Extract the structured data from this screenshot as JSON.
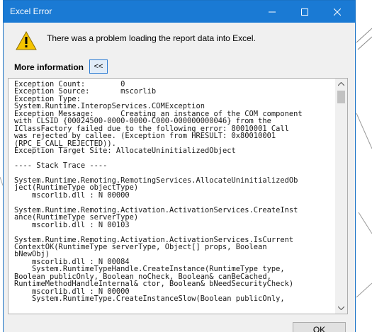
{
  "window": {
    "title": "Excel Error"
  },
  "message": {
    "text": "There was a problem loading the report data into Excel."
  },
  "more_info": {
    "label": "More information",
    "toggle_label": "<<"
  },
  "details": {
    "text": "Exception Count:        0\nException Source:       mscorlib\nException Type:\nSystem.Runtime.InteropServices.COMException\nException Message:      Creating an instance of the COM component\nwith CLSID {00024500-0000-0000-C000-000000000046} from the\nIClassFactory failed due to the following error: 80010001 Call\nwas rejected by callee. (Exception from HRESULT: 0x80010001\n(RPC_E_CALL_REJECTED)).\nException Target Site: AllocateUninitializedObject\n\n---- Stack Trace ----\n\nSystem.Runtime.Remoting.RemotingServices.AllocateUninitializedOb\nject(RuntimeType objectType)\n    mscorlib.dll : N 00000\n\nSystem.Runtime.Remoting.Activation.ActivationServices.CreateInst\nance(RuntimeType serverType)\n    mscorlib.dll : N 00103\n\nSystem.Runtime.Remoting.Activation.ActivationServices.IsCurrent\nContextOK(RuntimeType serverType, Object[] props, Boolean\nbNewObj)\n    mscorlib.dll : N 00084\n    System.RuntimeTypeHandle.CreateInstance(RuntimeType type,\nBoolean publicOnly, Boolean noCheck, Boolean& canBeCached,\nRuntimeMethodHandleInternal& ctor, Boolean& bNeedSecurityCheck)\n    mscorlib.dll : N 00000\n    System.RuntimeType.CreateInstanceSlow(Boolean publicOnly,"
  },
  "buttons": {
    "ok_label": "OK"
  },
  "icons": {
    "window_controls": [
      "minimize-icon",
      "maximize-icon",
      "close-icon"
    ],
    "message_icon": "warning-icon"
  },
  "colors": {
    "titlebar": "#1a7ad4",
    "warning": "#f5c400"
  }
}
